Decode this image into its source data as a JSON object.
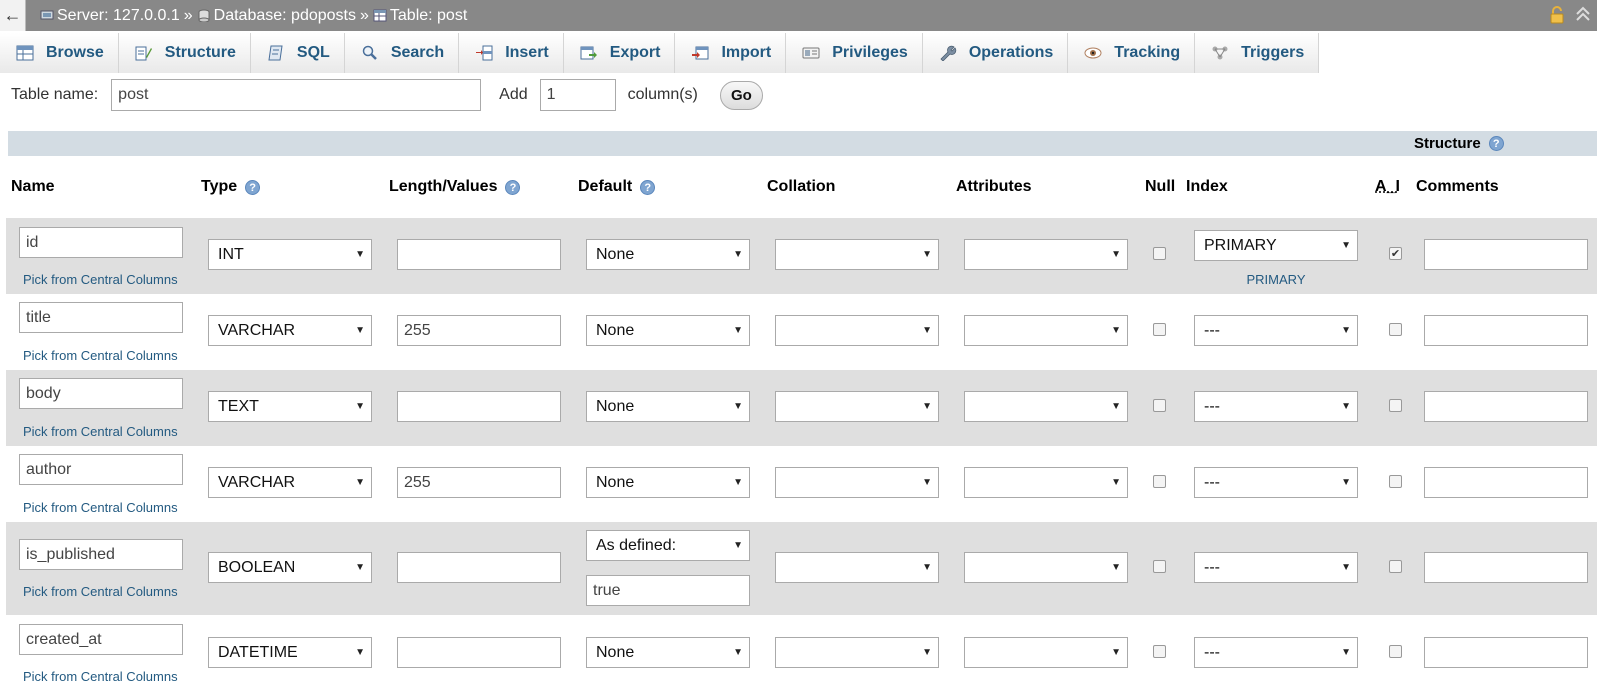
{
  "breadcrumb": {
    "back": "←",
    "server": "Server: 127.0.0.1",
    "database": "Database: pdoposts",
    "table": "Table: post",
    "separator": "»"
  },
  "tabs": [
    {
      "label": "Browse",
      "icon": "browse-icon"
    },
    {
      "label": "Structure",
      "icon": "structure-icon"
    },
    {
      "label": "SQL",
      "icon": "sql-icon"
    },
    {
      "label": "Search",
      "icon": "search-icon"
    },
    {
      "label": "Insert",
      "icon": "insert-icon"
    },
    {
      "label": "Export",
      "icon": "export-icon"
    },
    {
      "label": "Import",
      "icon": "import-icon"
    },
    {
      "label": "Privileges",
      "icon": "privileges-icon"
    },
    {
      "label": "Operations",
      "icon": "operations-icon"
    },
    {
      "label": "Tracking",
      "icon": "tracking-icon"
    },
    {
      "label": "Triggers",
      "icon": "triggers-icon"
    }
  ],
  "form": {
    "table_name_label": "Table name:",
    "table_name_value": "post",
    "add_label": "Add",
    "add_value": "1",
    "columns_label": "column(s)",
    "go_label": "Go"
  },
  "structure": {
    "title": "Structure",
    "help": "?"
  },
  "headers": {
    "name": "Name",
    "type": "Type",
    "length": "Length/Values",
    "default": "Default",
    "collation": "Collation",
    "attributes": "Attributes",
    "null": "Null",
    "index": "Index",
    "ai": "A_I",
    "comments": "Comments",
    "help": "?"
  },
  "pick_label": "Pick from Central Columns",
  "rows": [
    {
      "name": "id",
      "type": "INT",
      "length": "",
      "default": "None",
      "collation": "",
      "attributes": "",
      "null": false,
      "index": "PRIMARY",
      "index_note": "PRIMARY",
      "ai": true,
      "comments": ""
    },
    {
      "name": "title",
      "type": "VARCHAR",
      "length": "255",
      "default": "None",
      "collation": "",
      "attributes": "",
      "null": false,
      "index": "---",
      "ai": false,
      "comments": ""
    },
    {
      "name": "body",
      "type": "TEXT",
      "length": "",
      "default": "None",
      "collation": "",
      "attributes": "",
      "null": false,
      "index": "---",
      "ai": false,
      "comments": ""
    },
    {
      "name": "author",
      "type": "VARCHAR",
      "length": "255",
      "default": "None",
      "collation": "",
      "attributes": "",
      "null": false,
      "index": "---",
      "ai": false,
      "comments": ""
    },
    {
      "name": "is_published",
      "type": "BOOLEAN",
      "length": "",
      "default": "As defined:",
      "default_value": "true",
      "collation": "",
      "attributes": "",
      "null": false,
      "index": "---",
      "ai": false,
      "comments": ""
    },
    {
      "name": "created_at",
      "type": "DATETIME",
      "length": "",
      "default": "None",
      "collation": "",
      "attributes": "",
      "null": false,
      "index": "---",
      "ai": false,
      "comments": ""
    }
  ],
  "checkmark": "✔",
  "dropdown_arrow": "▼"
}
